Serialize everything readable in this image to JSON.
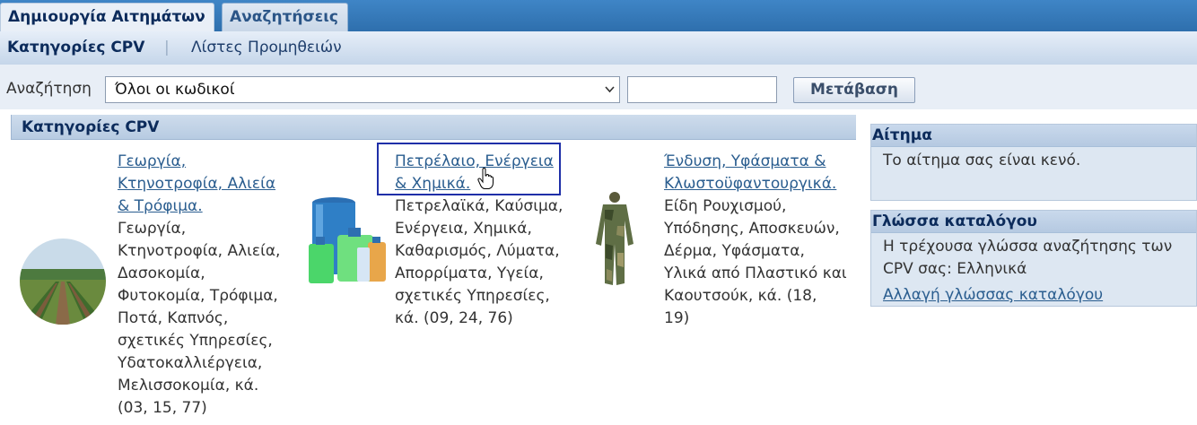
{
  "tabs": [
    {
      "label": "Δημιουργία Αιτημάτων",
      "active": true
    },
    {
      "label": "Αναζητήσεις",
      "active": false
    }
  ],
  "subnav": {
    "active": "Κατηγορίες CPV",
    "separator": "|",
    "other": "Λίστες Προμηθειών"
  },
  "search": {
    "label": "Αναζήτηση",
    "scope_selected": "Όλοι οι κωδικοί",
    "query_value": "",
    "go_label": "Μετάβαση"
  },
  "section": {
    "title": "Κατηγορίες CPV"
  },
  "categories": [
    {
      "link_lines": [
        "Γεωργία,",
        "Κτηνοτροφία, Αλιεία",
        "& Τρόφιμα."
      ],
      "desc_lines": [
        "Γεωργία,",
        "Κτηνοτροφία, Αλιεία,",
        "Δασοκομία,",
        "Φυτοκομία, Τρόφιμα,",
        "Ποτά, Καπνός,",
        "σχετικές Υπηρεσίες,",
        "Υδατοκαλλιέργεια,",
        "Μελισσοκομία, κά.",
        "(03, 15, 77)"
      ]
    },
    {
      "link_lines": [
        "Πετρέλαιο, Ενέργεια",
        "& Χημικά."
      ],
      "desc_lines": [
        "Πετρελαϊκά, Καύσιμα,",
        "Ενέργεια, Χημικά,",
        "Καθαρισμός, Λύματα,",
        "Απορρίματα, Υγεία,",
        "σχετικές Υπηρεσίες,",
        "κά. (09, 24, 76)"
      ]
    },
    {
      "link_lines": [
        "Ένδυση, Υφάσματα &",
        "Κλωστοϋφαντουργικά."
      ],
      "desc_lines": [
        "Είδη Ρουχισμού,",
        "Υπόδησης, Αποσκευών,",
        "Δέρμα, Υφάσματα,",
        "Υλικά από Πλαστικό και",
        "Καουτσούκ, κά. (18,",
        "19)"
      ]
    }
  ],
  "request_panel": {
    "title": "Αίτημα",
    "body": "Το αίτημα σας είναι κενό."
  },
  "language_panel": {
    "title": "Γλώσσα καταλόγου",
    "body_lines": [
      "Η τρέχουσα γλώσσα αναζήτησης των",
      "CPV σας: Ελληνικά"
    ],
    "link": "Αλλαγή γλώσσας καταλόγου"
  },
  "colors": {
    "tabbar": "#3475b7",
    "link": "#2a5d8f",
    "focus": "#1f2fa8",
    "header_text": "#0c2b5b"
  },
  "icons": {
    "thumb1": "vineyard-image",
    "thumb2": "chemical-containers-image",
    "thumb3": "camouflage-suit-image",
    "cursor": "hand-pointer-icon"
  }
}
